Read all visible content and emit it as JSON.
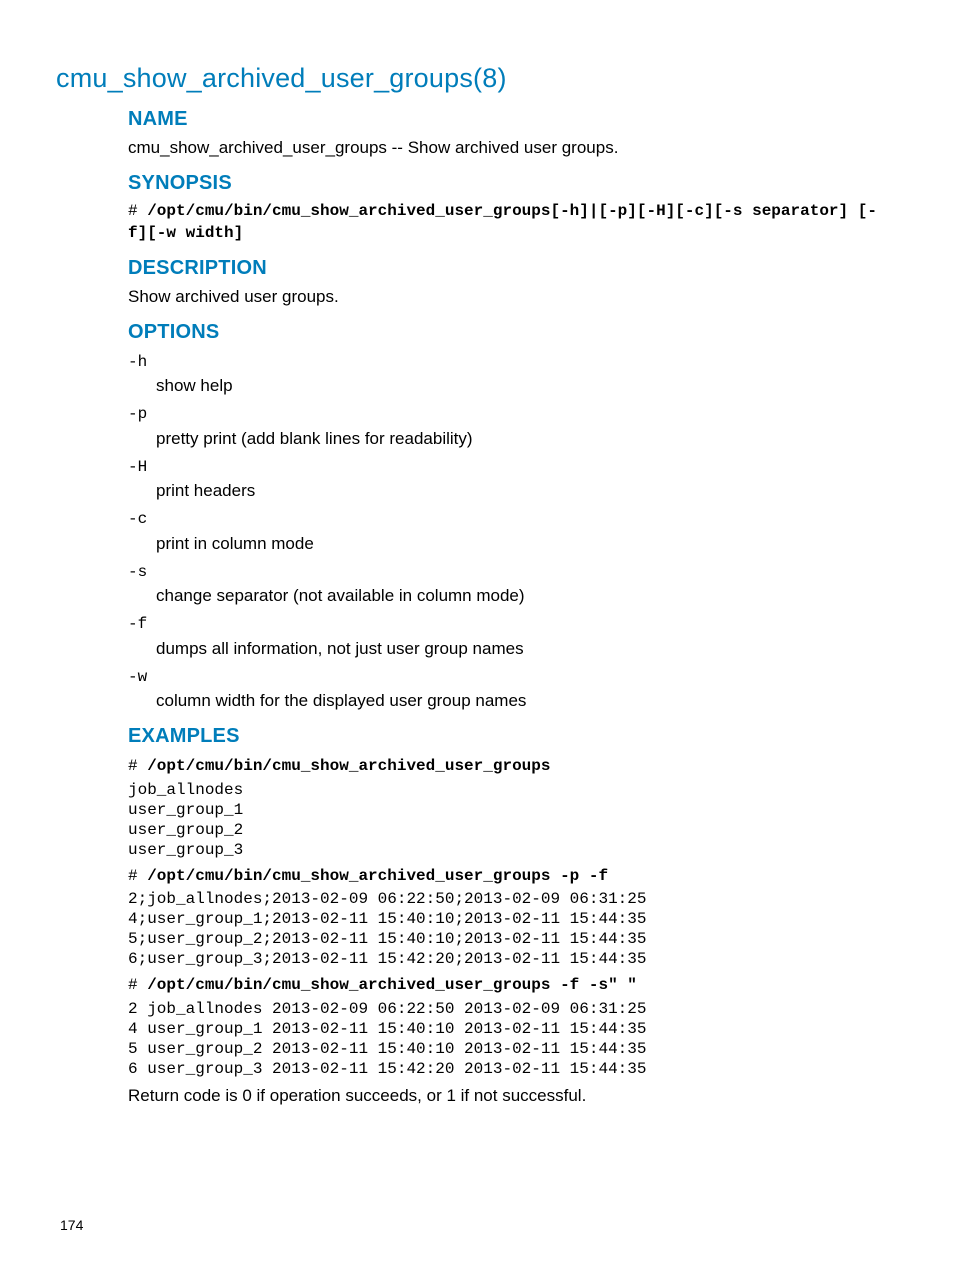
{
  "title": "cmu_show_archived_user_groups(8)",
  "sections": {
    "name": {
      "heading": "NAME",
      "text": "cmu_show_archived_user_groups -- Show archived user groups."
    },
    "synopsis": {
      "heading": "SYNOPSIS",
      "prefix": "# ",
      "cmd": "/opt/cmu/bin/cmu_show_archived_user_groups[-h]|[-p][-H][-c][-s separator] [-f][-w width]"
    },
    "description": {
      "heading": "DESCRIPTION",
      "text": "Show archived user groups."
    },
    "options": {
      "heading": "OPTIONS",
      "items": [
        {
          "flag": "-h",
          "desc": "show help"
        },
        {
          "flag": "-p",
          "desc": "pretty print (add blank lines for readability)"
        },
        {
          "flag": "-H",
          "desc": "print headers"
        },
        {
          "flag": "-c",
          "desc": "print in column mode"
        },
        {
          "flag": "-s",
          "desc": "change separator (not available in column mode)"
        },
        {
          "flag": "-f",
          "desc": "dumps all information, not just user group names"
        },
        {
          "flag": "-w",
          "desc": "column width for the displayed user group names"
        }
      ]
    },
    "examples": {
      "heading": "EXAMPLES",
      "blocks": [
        {
          "prefix": "# ",
          "cmd": "/opt/cmu/bin/cmu_show_archived_user_groups",
          "output": "job_allnodes\nuser_group_1\nuser_group_2\nuser_group_3"
        },
        {
          "prefix": "# ",
          "cmd": "/opt/cmu/bin/cmu_show_archived_user_groups -p -f",
          "output": "2;job_allnodes;2013-02-09 06:22:50;2013-02-09 06:31:25\n4;user_group_1;2013-02-11 15:40:10;2013-02-11 15:44:35\n5;user_group_2;2013-02-11 15:40:10;2013-02-11 15:44:35\n6;user_group_3;2013-02-11 15:42:20;2013-02-11 15:44:35"
        },
        {
          "prefix": "# ",
          "cmd": "/opt/cmu/bin/cmu_show_archived_user_groups -f -s\" \"",
          "output": "2 job_allnodes 2013-02-09 06:22:50 2013-02-09 06:31:25\n4 user_group_1 2013-02-11 15:40:10 2013-02-11 15:44:35\n5 user_group_2 2013-02-11 15:40:10 2013-02-11 15:44:35\n6 user_group_3 2013-02-11 15:42:20 2013-02-11 15:44:35"
        }
      ],
      "return_text": "Return code is 0 if operation succeeds, or 1 if not successful."
    }
  },
  "page_number": "174"
}
